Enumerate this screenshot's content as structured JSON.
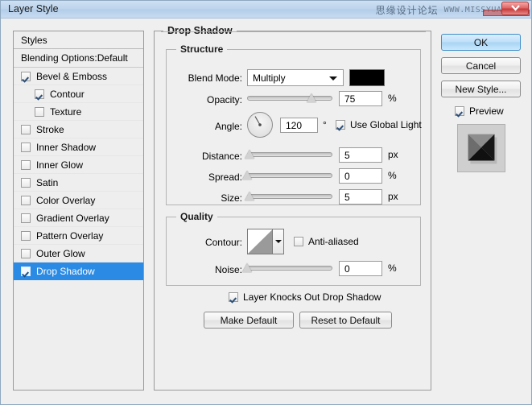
{
  "window": {
    "title": "Layer Style",
    "close_icon": "close-icon"
  },
  "watermark": {
    "chinese": "思缘设计论坛",
    "url": "WWW.MISSYUAN.COM"
  },
  "styles_panel": {
    "header": "Styles",
    "blending_options": "Blending Options:Default",
    "items": [
      {
        "label": "Bevel & Emboss",
        "checked": true,
        "indent": false,
        "selected": false
      },
      {
        "label": "Contour",
        "checked": true,
        "indent": true,
        "selected": false
      },
      {
        "label": "Texture",
        "checked": false,
        "indent": true,
        "selected": false
      },
      {
        "label": "Stroke",
        "checked": false,
        "indent": false,
        "selected": false
      },
      {
        "label": "Inner Shadow",
        "checked": false,
        "indent": false,
        "selected": false
      },
      {
        "label": "Inner Glow",
        "checked": false,
        "indent": false,
        "selected": false
      },
      {
        "label": "Satin",
        "checked": false,
        "indent": false,
        "selected": false
      },
      {
        "label": "Color Overlay",
        "checked": false,
        "indent": false,
        "selected": false
      },
      {
        "label": "Gradient Overlay",
        "checked": false,
        "indent": false,
        "selected": false
      },
      {
        "label": "Pattern Overlay",
        "checked": false,
        "indent": false,
        "selected": false
      },
      {
        "label": "Outer Glow",
        "checked": false,
        "indent": false,
        "selected": false
      },
      {
        "label": "Drop Shadow",
        "checked": true,
        "indent": false,
        "selected": true
      }
    ],
    "selected_color": "#2a8ae4"
  },
  "main": {
    "group_title": "Drop Shadow",
    "structure": {
      "title": "Structure",
      "blend_mode_label": "Blend Mode:",
      "blend_mode_value": "Multiply",
      "shadow_color": "#000000",
      "opacity_label": "Opacity:",
      "opacity_value": "75",
      "opacity_unit": "%",
      "opacity_percent": 75,
      "angle_label": "Angle:",
      "angle_value": "120",
      "angle_unit": "°",
      "angle_degrees": 120,
      "use_global_light": "Use Global Light",
      "use_global_light_checked": true,
      "distance_label": "Distance:",
      "distance_value": "5",
      "distance_unit": "px",
      "distance_percent": 3,
      "spread_label": "Spread:",
      "spread_value": "0",
      "spread_unit": "%",
      "spread_percent": 0,
      "size_label": "Size:",
      "size_value": "5",
      "size_unit": "px",
      "size_percent": 3
    },
    "quality": {
      "title": "Quality",
      "contour_label": "Contour:",
      "anti_aliased_label": "Anti-aliased",
      "anti_aliased_checked": false,
      "noise_label": "Noise:",
      "noise_value": "0",
      "noise_unit": "%",
      "noise_percent": 0
    },
    "knockout_label": "Layer Knocks Out Drop Shadow",
    "knockout_checked": true,
    "make_default_label": "Make Default",
    "reset_default_label": "Reset to Default"
  },
  "right": {
    "ok_label": "OK",
    "cancel_label": "Cancel",
    "new_style_label": "New Style...",
    "preview_label": "Preview",
    "preview_checked": true
  }
}
